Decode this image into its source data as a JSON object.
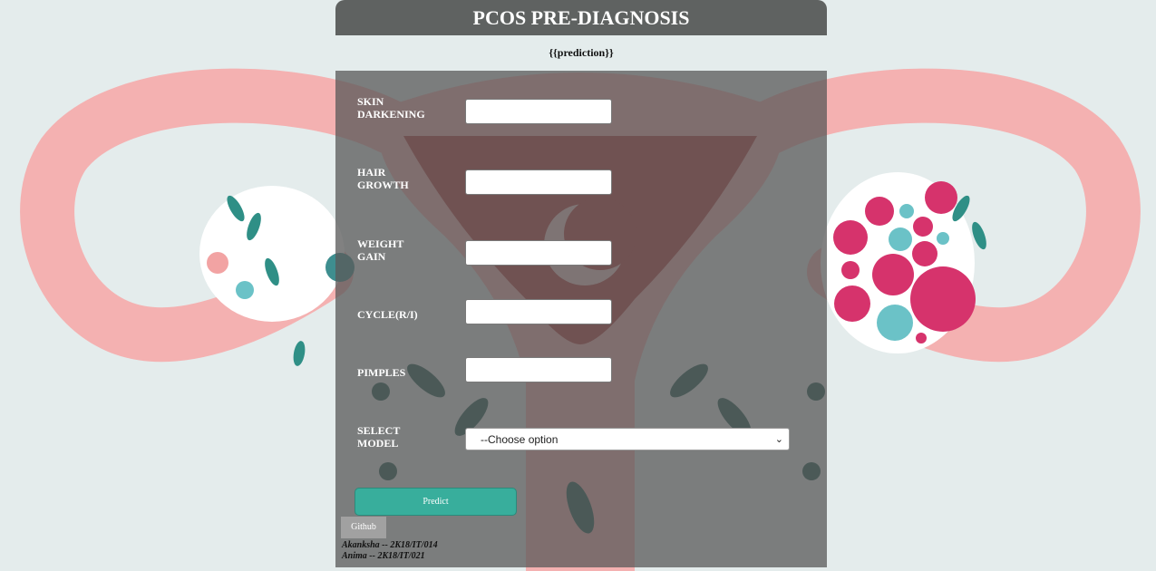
{
  "header": {
    "title": "PCOS PRE-DIAGNOSIS"
  },
  "prediction_text": "{{prediction}}",
  "form": {
    "fields": [
      {
        "label_line1": "SKIN",
        "label_line2": "DARKENING",
        "value": ""
      },
      {
        "label_line1": "HAIR",
        "label_line2": "GROWTH",
        "value": ""
      },
      {
        "label_line1": "WEIGHT",
        "label_line2": "GAIN",
        "value": ""
      },
      {
        "label_line1": "CYCLE(R/I)",
        "label_line2": "",
        "value": ""
      },
      {
        "label_line1": "PIMPLES",
        "label_line2": "",
        "value": ""
      }
    ],
    "model_select": {
      "label_line1": "SELECT",
      "label_line2": "MODEL",
      "selected": "--Choose option"
    },
    "predict_label": "Predict"
  },
  "footer": {
    "github_label": "Github",
    "credits": [
      "Akanksha -- 2K18/IT/014",
      "Anima -- 2K18/IT/021"
    ]
  },
  "colors": {
    "header_bg": "#5f6261",
    "predict_bg": "#38ae9c",
    "page_bg": "#e4ecec"
  }
}
